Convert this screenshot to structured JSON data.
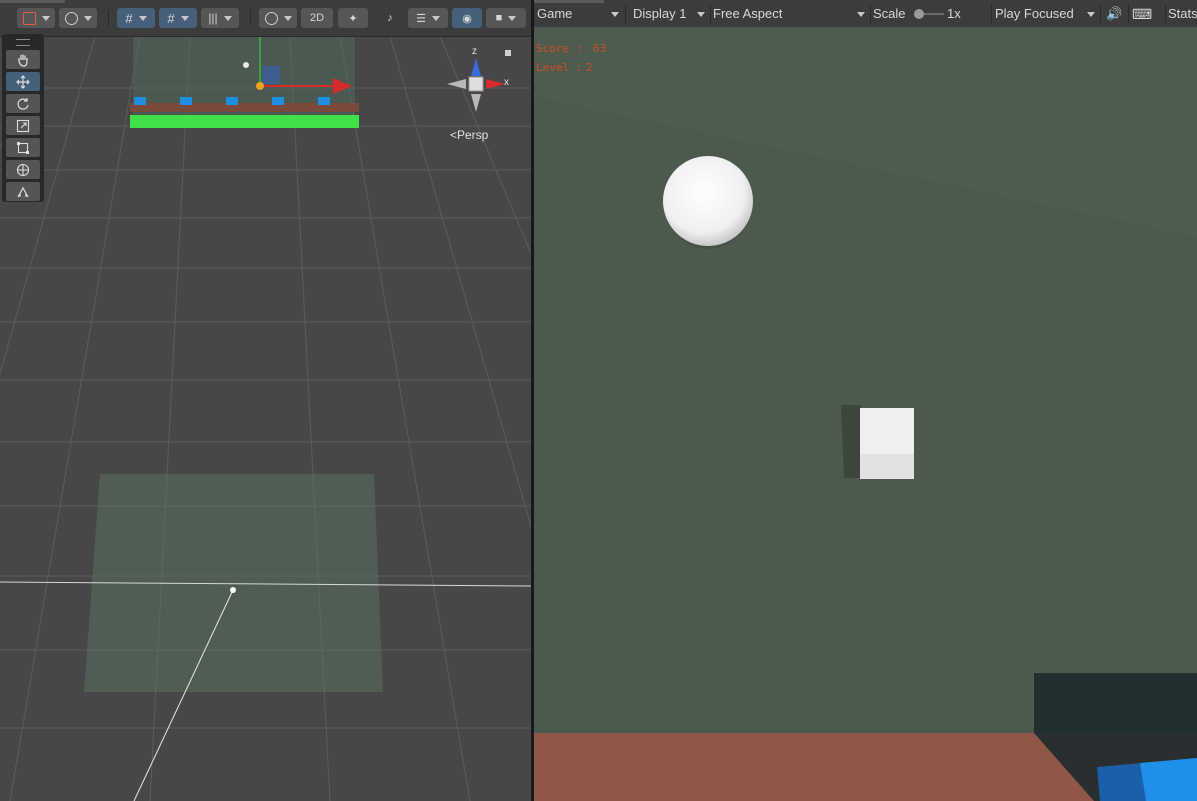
{
  "scene": {
    "toolbar": {
      "btn_2d_label": "2D"
    },
    "gizmo": {
      "z_label": "z",
      "x_label": "x",
      "persp_label": "<Persp"
    },
    "tools": [
      "hand",
      "move",
      "rotate",
      "scale",
      "rect",
      "transform",
      "custom"
    ]
  },
  "game": {
    "toolbar": {
      "view_label": "Game",
      "display_label": "Display 1",
      "aspect_label": "Free Aspect",
      "scale_label": "Scale",
      "scale_value": "1x",
      "play_mode_label": "Play Focused",
      "stats_label": "Stats"
    },
    "hud": {
      "score_label": "Score :",
      "score_value": "63",
      "level_label": "Level :",
      "level_value": "2"
    }
  },
  "colors": {
    "scene_bg": "#474747",
    "game_bg": "#4c5a4b",
    "ground": "#8e5748",
    "hud_text": "#d24a2a",
    "selected_tool": "#46607c"
  }
}
